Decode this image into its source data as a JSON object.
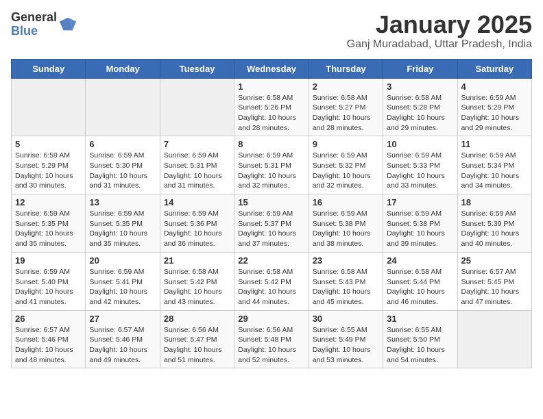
{
  "header": {
    "logo_general": "General",
    "logo_blue": "Blue",
    "month_title": "January 2025",
    "location": "Ganj Muradabad, Uttar Pradesh, India"
  },
  "days_of_week": [
    "Sunday",
    "Monday",
    "Tuesday",
    "Wednesday",
    "Thursday",
    "Friday",
    "Saturday"
  ],
  "weeks": [
    [
      {
        "day": "",
        "info": ""
      },
      {
        "day": "",
        "info": ""
      },
      {
        "day": "",
        "info": ""
      },
      {
        "day": "1",
        "info": "Sunrise: 6:58 AM\nSunset: 5:26 PM\nDaylight: 10 hours\nand 28 minutes."
      },
      {
        "day": "2",
        "info": "Sunrise: 6:58 AM\nSunset: 5:27 PM\nDaylight: 10 hours\nand 28 minutes."
      },
      {
        "day": "3",
        "info": "Sunrise: 6:58 AM\nSunset: 5:28 PM\nDaylight: 10 hours\nand 29 minutes."
      },
      {
        "day": "4",
        "info": "Sunrise: 6:59 AM\nSunset: 5:29 PM\nDaylight: 10 hours\nand 29 minutes."
      }
    ],
    [
      {
        "day": "5",
        "info": "Sunrise: 6:59 AM\nSunset: 5:29 PM\nDaylight: 10 hours\nand 30 minutes."
      },
      {
        "day": "6",
        "info": "Sunrise: 6:59 AM\nSunset: 5:30 PM\nDaylight: 10 hours\nand 31 minutes."
      },
      {
        "day": "7",
        "info": "Sunrise: 6:59 AM\nSunset: 5:31 PM\nDaylight: 10 hours\nand 31 minutes."
      },
      {
        "day": "8",
        "info": "Sunrise: 6:59 AM\nSunset: 5:31 PM\nDaylight: 10 hours\nand 32 minutes."
      },
      {
        "day": "9",
        "info": "Sunrise: 6:59 AM\nSunset: 5:32 PM\nDaylight: 10 hours\nand 32 minutes."
      },
      {
        "day": "10",
        "info": "Sunrise: 6:59 AM\nSunset: 5:33 PM\nDaylight: 10 hours\nand 33 minutes."
      },
      {
        "day": "11",
        "info": "Sunrise: 6:59 AM\nSunset: 5:34 PM\nDaylight: 10 hours\nand 34 minutes."
      }
    ],
    [
      {
        "day": "12",
        "info": "Sunrise: 6:59 AM\nSunset: 5:35 PM\nDaylight: 10 hours\nand 35 minutes."
      },
      {
        "day": "13",
        "info": "Sunrise: 6:59 AM\nSunset: 5:35 PM\nDaylight: 10 hours\nand 35 minutes."
      },
      {
        "day": "14",
        "info": "Sunrise: 6:59 AM\nSunset: 5:36 PM\nDaylight: 10 hours\nand 36 minutes."
      },
      {
        "day": "15",
        "info": "Sunrise: 6:59 AM\nSunset: 5:37 PM\nDaylight: 10 hours\nand 37 minutes."
      },
      {
        "day": "16",
        "info": "Sunrise: 6:59 AM\nSunset: 5:38 PM\nDaylight: 10 hours\nand 38 minutes."
      },
      {
        "day": "17",
        "info": "Sunrise: 6:59 AM\nSunset: 5:38 PM\nDaylight: 10 hours\nand 39 minutes."
      },
      {
        "day": "18",
        "info": "Sunrise: 6:59 AM\nSunset: 5:39 PM\nDaylight: 10 hours\nand 40 minutes."
      }
    ],
    [
      {
        "day": "19",
        "info": "Sunrise: 6:59 AM\nSunset: 5:40 PM\nDaylight: 10 hours\nand 41 minutes."
      },
      {
        "day": "20",
        "info": "Sunrise: 6:59 AM\nSunset: 5:41 PM\nDaylight: 10 hours\nand 42 minutes."
      },
      {
        "day": "21",
        "info": "Sunrise: 6:58 AM\nSunset: 5:42 PM\nDaylight: 10 hours\nand 43 minutes."
      },
      {
        "day": "22",
        "info": "Sunrise: 6:58 AM\nSunset: 5:42 PM\nDaylight: 10 hours\nand 44 minutes."
      },
      {
        "day": "23",
        "info": "Sunrise: 6:58 AM\nSunset: 5:43 PM\nDaylight: 10 hours\nand 45 minutes."
      },
      {
        "day": "24",
        "info": "Sunrise: 6:58 AM\nSunset: 5:44 PM\nDaylight: 10 hours\nand 46 minutes."
      },
      {
        "day": "25",
        "info": "Sunrise: 6:57 AM\nSunset: 5:45 PM\nDaylight: 10 hours\nand 47 minutes."
      }
    ],
    [
      {
        "day": "26",
        "info": "Sunrise: 6:57 AM\nSunset: 5:46 PM\nDaylight: 10 hours\nand 48 minutes."
      },
      {
        "day": "27",
        "info": "Sunrise: 6:57 AM\nSunset: 5:46 PM\nDaylight: 10 hours\nand 49 minutes."
      },
      {
        "day": "28",
        "info": "Sunrise: 6:56 AM\nSunset: 5:47 PM\nDaylight: 10 hours\nand 51 minutes."
      },
      {
        "day": "29",
        "info": "Sunrise: 6:56 AM\nSunset: 5:48 PM\nDaylight: 10 hours\nand 52 minutes."
      },
      {
        "day": "30",
        "info": "Sunrise: 6:55 AM\nSunset: 5:49 PM\nDaylight: 10 hours\nand 53 minutes."
      },
      {
        "day": "31",
        "info": "Sunrise: 6:55 AM\nSunset: 5:50 PM\nDaylight: 10 hours\nand 54 minutes."
      },
      {
        "day": "",
        "info": ""
      }
    ]
  ]
}
